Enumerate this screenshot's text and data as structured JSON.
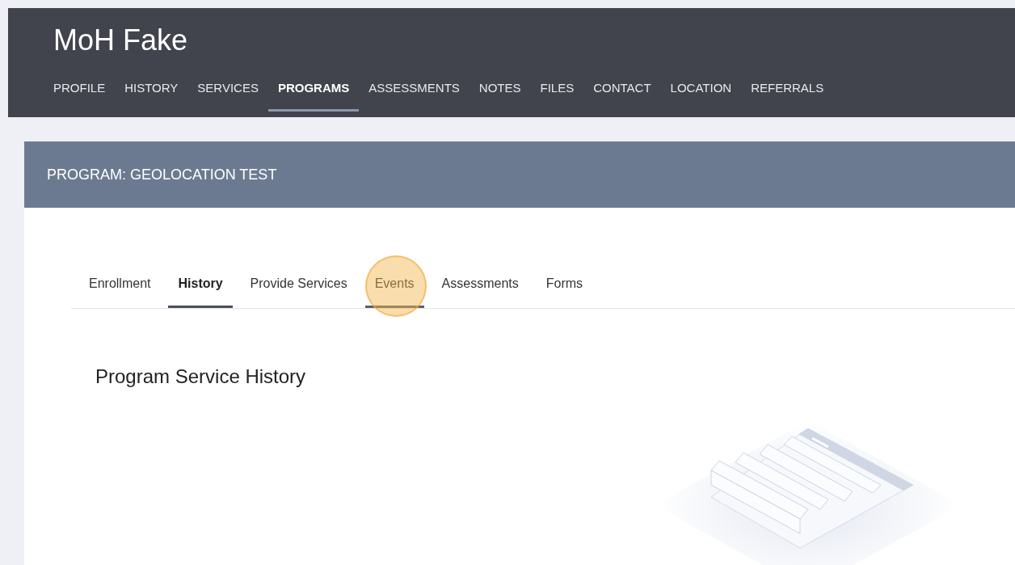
{
  "app": {
    "title": "MoH Fake"
  },
  "nav": [
    {
      "label": "PROFILE",
      "selected": false
    },
    {
      "label": "HISTORY",
      "selected": false
    },
    {
      "label": "SERVICES",
      "selected": false
    },
    {
      "label": "PROGRAMS",
      "selected": true
    },
    {
      "label": "ASSESSMENTS",
      "selected": false
    },
    {
      "label": "NOTES",
      "selected": false
    },
    {
      "label": "FILES",
      "selected": false
    },
    {
      "label": "CONTACT",
      "selected": false
    },
    {
      "label": "LOCATION",
      "selected": false
    },
    {
      "label": "REFERRALS",
      "selected": false
    }
  ],
  "program": {
    "title": "PROGRAM: GEOLOCATION TEST",
    "tabs": [
      {
        "label": "Enrollment",
        "selected": false,
        "hovered": false
      },
      {
        "label": "History",
        "selected": true,
        "hovered": false
      },
      {
        "label": "Provide Services",
        "selected": false,
        "hovered": false
      },
      {
        "label": "Events",
        "selected": false,
        "hovered": true
      },
      {
        "label": "Assessments",
        "selected": false,
        "hovered": false
      },
      {
        "label": "Forms",
        "selected": false,
        "hovered": false
      }
    ],
    "heading": "Program Service History"
  }
}
